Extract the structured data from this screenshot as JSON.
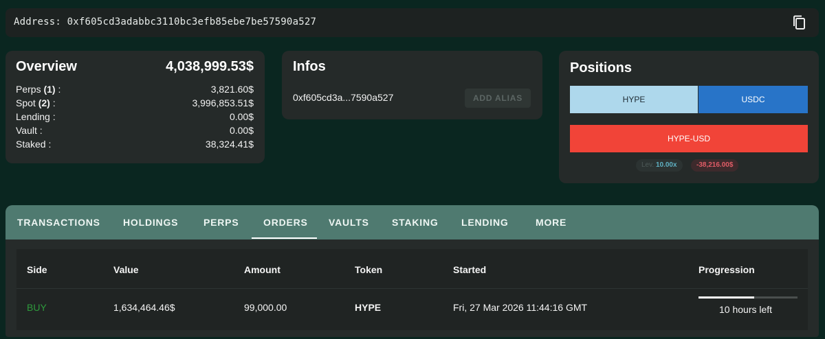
{
  "address": {
    "label": "Address:",
    "value": "0xf605cd3adabbc3110bc3efb85ebe7be57590a527",
    "copy_icon": "copy-icon"
  },
  "overview": {
    "title": "Overview",
    "total": "4,038,999.53$",
    "rows": [
      {
        "label": "Perps",
        "count": "(1)",
        "suffix": " :",
        "value": "3,821.60$"
      },
      {
        "label": "Spot",
        "count": "(2)",
        "suffix": " :",
        "value": "3,996,853.51$"
      },
      {
        "label": "Lending :",
        "value": "0.00$"
      },
      {
        "label": "Vault :",
        "value": "0.00$"
      },
      {
        "label": "Staked :",
        "value": "38,324.41$"
      }
    ]
  },
  "infos": {
    "title": "Infos",
    "short_address": "0xf605cd3a...7590a527",
    "add_alias": "ADD ALIAS"
  },
  "positions": {
    "title": "Positions",
    "token_a": "HYPE",
    "token_b": "USDC",
    "pair": "HYPE-USD",
    "lev_label": "Lev.",
    "lev_value": "10.00x",
    "pnl": "-38,216.00$"
  },
  "tabs": {
    "items": [
      "TRANSACTIONS",
      "HOLDINGS",
      "PERPS",
      "ORDERS",
      "VAULTS",
      "STAKING",
      "LENDING",
      "MORE"
    ],
    "active": "ORDERS"
  },
  "orders": {
    "headers": [
      "Side",
      "Value",
      "Amount",
      "Token",
      "Started",
      "Progression"
    ],
    "rows": [
      {
        "side": "BUY",
        "value": "1,634,464.46$",
        "amount": "99,000.00",
        "token": "HYPE",
        "started": "Fri, 27 Mar 2026 11:44:16 GMT",
        "progress": 0.56,
        "time_left": "10 hours left"
      }
    ]
  },
  "colors": {
    "background": "#0a2620",
    "card": "#252a29",
    "tab_bar": "#4f7a70",
    "buy_green": "#2e9a3c",
    "hype_blue": "#aed8ec",
    "usdc_blue": "#2874c8",
    "short_red": "#f14438"
  }
}
